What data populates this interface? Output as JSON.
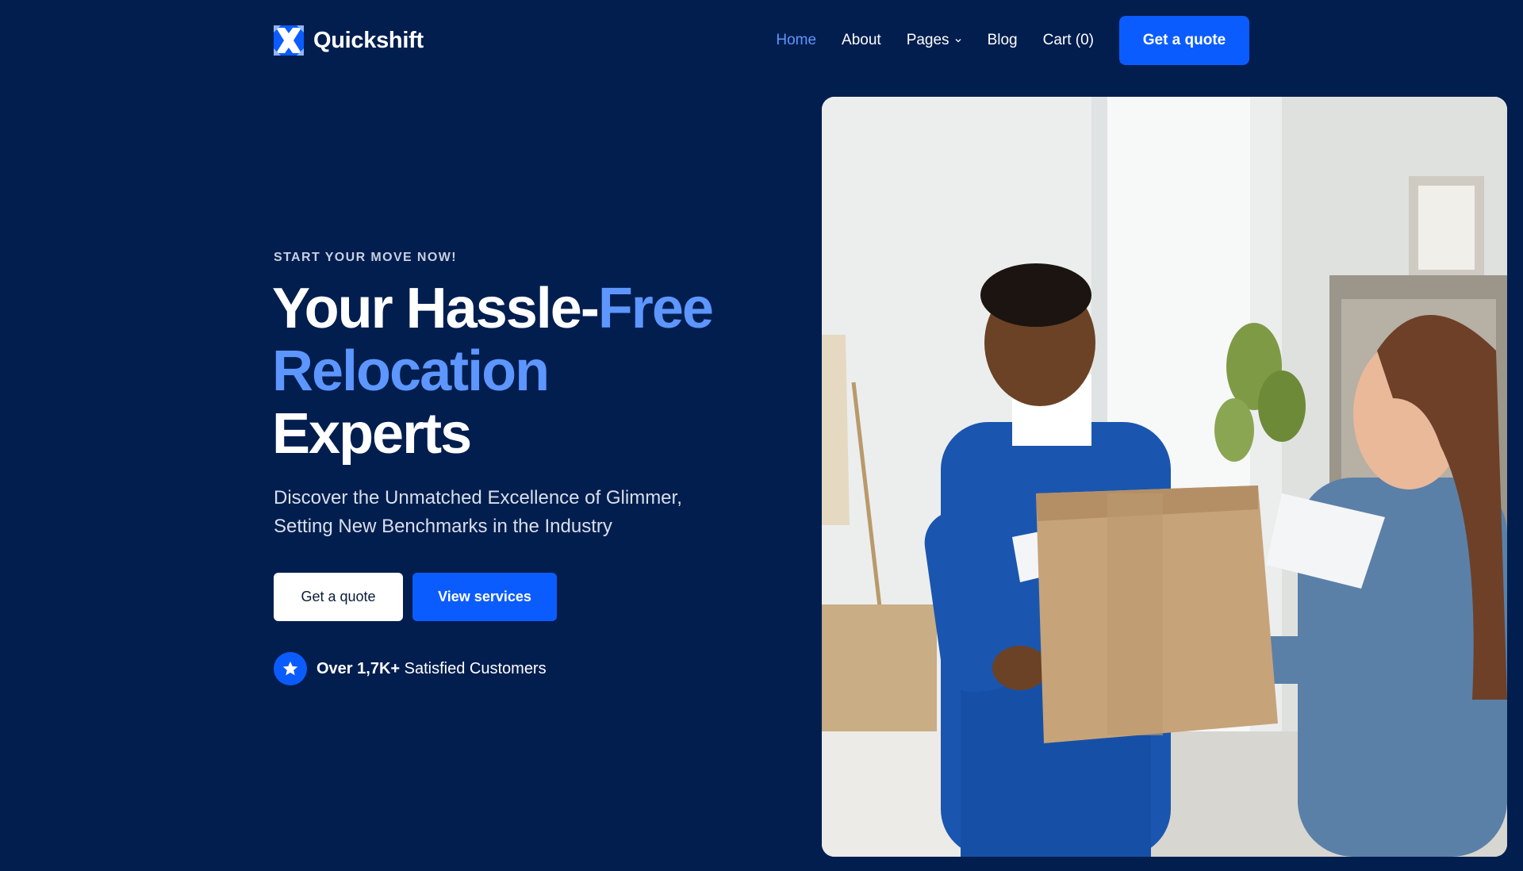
{
  "brand": {
    "name": "Quickshift",
    "logo_icon": "x-arrows-logo-icon",
    "accent_color": "#0b5cff",
    "highlight_color": "#5d96ff",
    "background_color": "#021e4f"
  },
  "nav": {
    "items": [
      {
        "label": "Home",
        "active": true
      },
      {
        "label": "About",
        "active": false
      },
      {
        "label": "Pages",
        "active": false,
        "dropdown": true
      },
      {
        "label": "Blog",
        "active": false
      },
      {
        "label": "Cart (0)",
        "active": false
      }
    ],
    "cta_label": "Get a quote"
  },
  "hero": {
    "eyebrow": "START YOUR MOVE NOW!",
    "headline": {
      "part1": "Your Hassle-",
      "highlight": "Free Relocation",
      "part2": "Experts"
    },
    "subtext": "Discover the Unmatched Excellence of Glimmer, Setting New Benchmarks in the Industry",
    "primary_button": "Get a quote",
    "secondary_button": "View services",
    "proof": {
      "icon": "star-icon",
      "bold": "Over 1,7K+",
      "rest": "Satisfied Customers"
    }
  }
}
